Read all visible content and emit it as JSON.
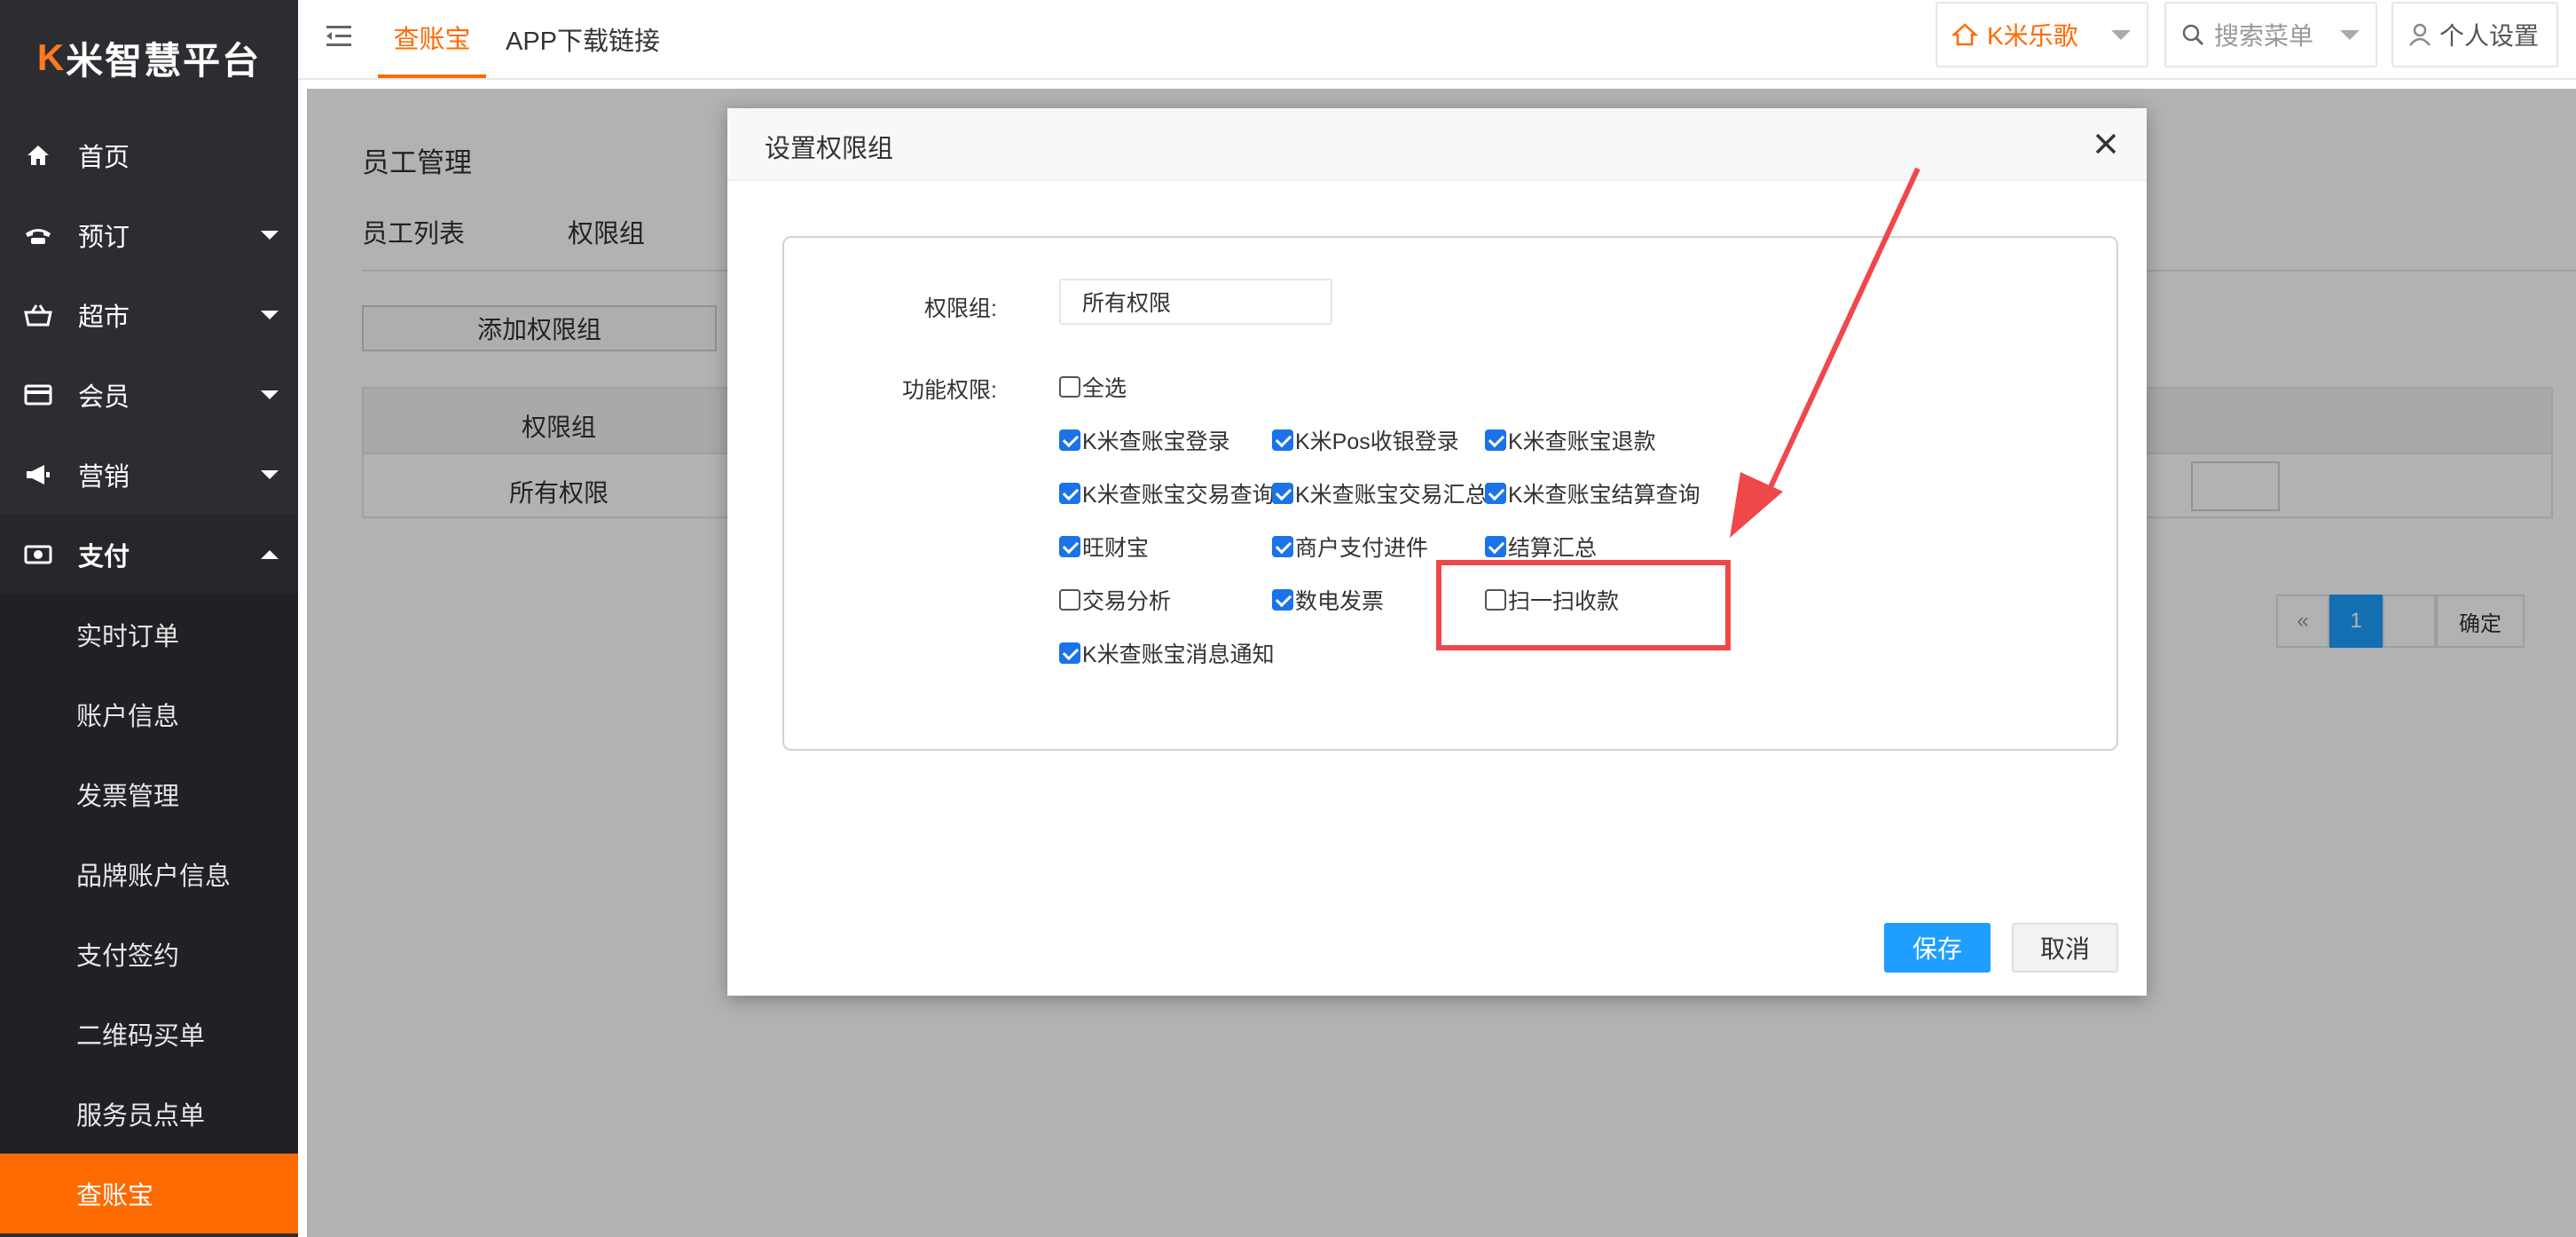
{
  "app": {
    "logo_text": "K米智慧平台",
    "logo_k": "K",
    "logo_rest": "米智慧平台"
  },
  "sidebar": {
    "items": [
      {
        "label": "首页",
        "icon": "home-icon"
      },
      {
        "label": "预订",
        "icon": "phone-icon"
      },
      {
        "label": "超市",
        "icon": "basket-icon"
      },
      {
        "label": "会员",
        "icon": "card-icon"
      },
      {
        "label": "营销",
        "icon": "megaphone-icon"
      },
      {
        "label": "支付",
        "icon": "money-icon"
      }
    ],
    "subitems": [
      "实时订单",
      "账户信息",
      "发票管理",
      "品牌账户信息",
      "支付签约",
      "二维码买单",
      "服务员点单",
      "查账宝"
    ]
  },
  "topbar": {
    "tab_active": "查账宝",
    "tab_download": "APP下载链接",
    "store": "K米乐歌",
    "search_placeholder": "搜索菜单",
    "personal": "个人设置"
  },
  "page": {
    "title": "员工管理",
    "tabs": [
      "员工列表",
      "权限组"
    ],
    "add_button": "添加权限组",
    "table_header": "权限组",
    "table_row": "所有权限",
    "pager": {
      "prev": "«",
      "current": "1",
      "confirm": "确定"
    }
  },
  "modal": {
    "title": "设置权限组",
    "group_label": "权限组:",
    "group_value": "所有权限",
    "func_label": "功能权限:",
    "select_all": "全选",
    "permissions": [
      {
        "label": "K米查账宝登录",
        "checked": true
      },
      {
        "label": "K米Pos收银登录",
        "checked": true
      },
      {
        "label": "K米查账宝退款",
        "checked": true
      },
      {
        "label": "K米查账宝交易查询",
        "checked": true
      },
      {
        "label": "K米查账宝交易汇总",
        "checked": true
      },
      {
        "label": "K米查账宝结算查询",
        "checked": true
      },
      {
        "label": "旺财宝",
        "checked": true
      },
      {
        "label": "商户支付进件",
        "checked": true
      },
      {
        "label": "结算汇总",
        "checked": true
      },
      {
        "label": "交易分析",
        "checked": false
      },
      {
        "label": "数电发票",
        "checked": true
      },
      {
        "label": "扫一扫收款",
        "checked": false
      },
      {
        "label": "K米查账宝消息通知",
        "checked": true
      }
    ],
    "save": "保存",
    "cancel": "取消"
  },
  "colors": {
    "accent": "#ff6a00",
    "primary": "#1e9fff",
    "annotation": "#f0484a"
  }
}
